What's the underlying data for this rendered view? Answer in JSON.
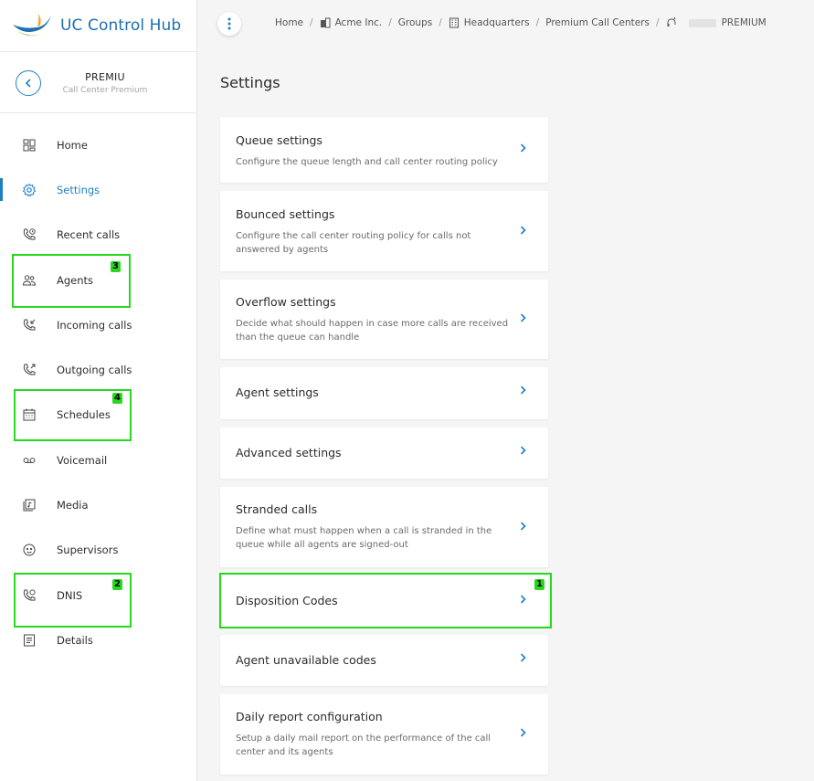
{
  "app": {
    "brand_name": "UC Control Hub"
  },
  "entity": {
    "name": "PREMIU",
    "subtitle": "Call Center Premium"
  },
  "nav": [
    {
      "label": "Home",
      "icon": "dashboard-icon"
    },
    {
      "label": "Settings",
      "icon": "gear-icon",
      "active": true
    },
    {
      "label": "Recent calls",
      "icon": "phone-clock-icon"
    },
    {
      "label": "Agents",
      "icon": "users-icon"
    },
    {
      "label": "Incoming calls",
      "icon": "phone-incoming-icon"
    },
    {
      "label": "Outgoing calls",
      "icon": "phone-outgoing-icon"
    },
    {
      "label": "Schedules",
      "icon": "calendar-icon"
    },
    {
      "label": "Voicemail",
      "icon": "voicemail-icon"
    },
    {
      "label": "Media",
      "icon": "media-icon"
    },
    {
      "label": "Supervisors",
      "icon": "supervisor-icon"
    },
    {
      "label": "DNIS",
      "icon": "phone-dnis-icon"
    },
    {
      "label": "Details",
      "icon": "details-icon"
    }
  ],
  "breadcrumb": {
    "home": "Home",
    "org": "Acme Inc.",
    "groups": "Groups",
    "site": "Headquarters",
    "section": "Premium Call Centers",
    "current": "PREMIUM"
  },
  "page": {
    "title": "Settings"
  },
  "cards": [
    {
      "title": "Queue settings",
      "desc": "Configure the queue length and call center routing policy"
    },
    {
      "title": "Bounced settings",
      "desc": "Configure the call center routing policy for calls not answered by agents"
    },
    {
      "title": "Overflow settings",
      "desc": "Decide what should happen in case more calls are received than the queue can handle"
    },
    {
      "title": "Agent settings",
      "desc": ""
    },
    {
      "title": "Advanced settings",
      "desc": ""
    },
    {
      "title": "Stranded calls",
      "desc": "Define what must happen when a call is stranded in the queue while all agents are signed-out"
    },
    {
      "title": "Disposition Codes",
      "desc": ""
    },
    {
      "title": "Agent unavailable codes",
      "desc": ""
    },
    {
      "title": "Daily report configuration",
      "desc": "Setup a daily mail report on the performance of the call center and its agents"
    }
  ],
  "annotations": {
    "a1": "1",
    "a2": "2",
    "a3": "3",
    "a4": "4"
  },
  "colors": {
    "accent": "#1f7fc4",
    "highlight": "#27d81f",
    "brand": "#1f6fb2"
  }
}
